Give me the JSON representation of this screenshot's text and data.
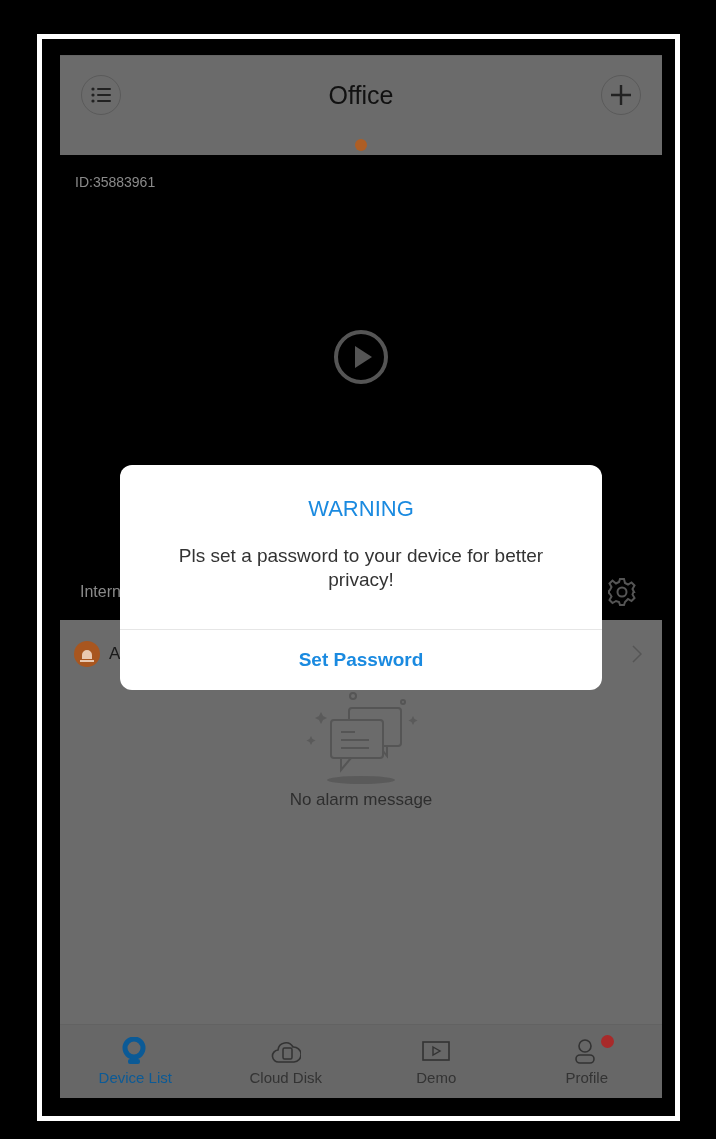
{
  "header": {
    "title": "Office",
    "page_dots": [
      {
        "selected": true
      }
    ]
  },
  "video": {
    "device_id": "ID:35883961",
    "network_label": "Intern"
  },
  "alarm": {
    "label": "A",
    "empty_text": "No alarm message"
  },
  "tabs": [
    {
      "label": "Device List",
      "kind": "camera",
      "selected": true,
      "badge": false
    },
    {
      "label": "Cloud Disk",
      "kind": "cloud",
      "selected": false,
      "badge": false
    },
    {
      "label": "Demo",
      "kind": "play",
      "selected": false,
      "badge": false
    },
    {
      "label": "Profile",
      "kind": "person",
      "selected": false,
      "badge": true
    }
  ],
  "dialog": {
    "title": "WARNING",
    "message": "Pls set a password to your device for better privacy!",
    "button": "Set Password"
  }
}
